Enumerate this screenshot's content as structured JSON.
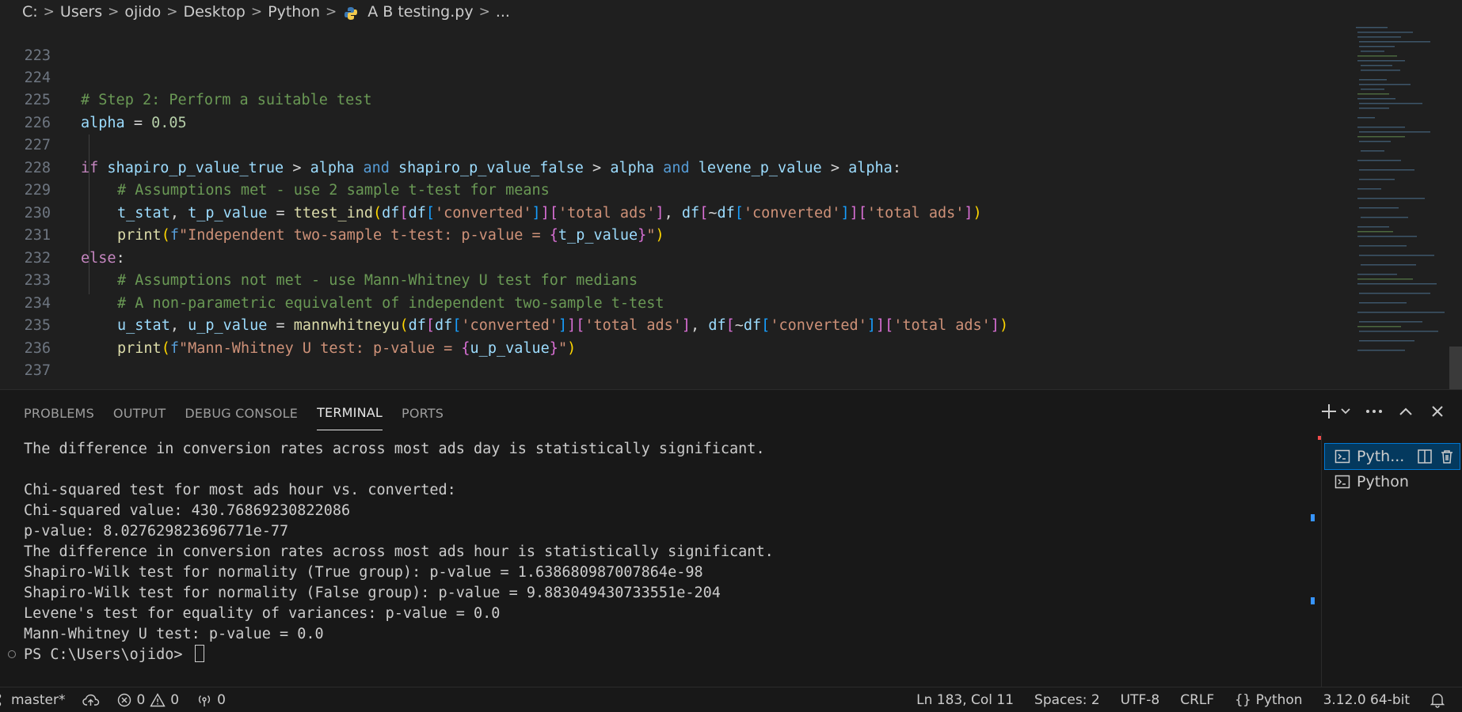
{
  "breadcrumb": {
    "parts": [
      "C:",
      "Users",
      "ojido",
      "Desktop",
      "Python"
    ],
    "file": "A B testing.py",
    "ellipsis": "..."
  },
  "editor": {
    "line_numbers": [
      "223",
      "224",
      "225",
      "226",
      "227",
      "228",
      "229",
      "230",
      "231",
      "232",
      "233",
      "234",
      "235",
      "236",
      "237"
    ],
    "lines": {
      "l224": "# Step 2: Perform a suitable test",
      "l225_var": "alpha",
      "l225_eq": " = ",
      "l225_num": "0.05",
      "l227": {
        "kw_if": "if ",
        "v1": "shapiro_p_value_true",
        "gt1": " > ",
        "a1": "alpha",
        "and1": " and ",
        "v2": "shapiro_p_value_false",
        "gt2": " > ",
        "a2": "alpha",
        "and2": " and ",
        "v3": "levene_p_value",
        "gt3": " > ",
        "a3": "alpha",
        "colon": ":"
      },
      "l228": "# Assumptions met - use 2 sample t-test for means",
      "l229": {
        "v1": "t_stat",
        "comma": ", ",
        "v2": "t_p_value",
        "eq": " = ",
        "fn": "ttest_ind",
        "p1": "(",
        "df1": "df",
        "b1": "[",
        "df2": "df",
        "b2": "[",
        "s1": "'converted'",
        "b2c": "]",
        "b1c": "]",
        "b3": "[",
        "s2": "'total ads'",
        "b3c": "]",
        "comma2": ", ",
        "df3": "df",
        "b4": "[",
        "tilde": "~",
        "df4": "df",
        "b5": "[",
        "s3": "'converted'",
        "b5c": "]",
        "b4c": "]",
        "b6": "[",
        "s4": "'total ads'",
        "b6c": "]",
        "p1c": ")"
      },
      "l230": {
        "fn": "print",
        "p": "(",
        "f": "f",
        "s": "\"Independent two-sample t-test: p-value = ",
        "cb": "{",
        "v": "t_p_value",
        "cbc": "}",
        "e": "\"",
        "pc": ")"
      },
      "l231": "else",
      "l231_colon": ":",
      "l232": "# Assumptions not met - use Mann-Whitney U test for medians",
      "l233": "# A non-parametric equivalent of independent two-sample t-test",
      "l234": {
        "v1": "u_stat",
        "comma": ", ",
        "v2": "u_p_value",
        "eq": " = ",
        "fn": "mannwhitneyu",
        "p1": "(",
        "df1": "df",
        "b1": "[",
        "df2": "df",
        "b2": "[",
        "s1": "'converted'",
        "b2c": "]",
        "b1c": "]",
        "b3": "[",
        "s2": "'total ads'",
        "b3c": "]",
        "comma2": ", ",
        "df3": "df",
        "b4": "[",
        "tilde": "~",
        "df4": "df",
        "b5": "[",
        "s3": "'converted'",
        "b5c": "]",
        "b4c": "]",
        "b6": "[",
        "s4": "'total ads'",
        "b6c": "]",
        "p1c": ")"
      },
      "l235": {
        "fn": "print",
        "p": "(",
        "f": "f",
        "s": "\"Mann-Whitney U test: p-value = ",
        "cb": "{",
        "v": "u_p_value",
        "cbc": "}",
        "e": "\"",
        "pc": ")"
      }
    }
  },
  "panel": {
    "tabs": [
      "PROBLEMS",
      "OUTPUT",
      "DEBUG CONSOLE",
      "TERMINAL",
      "PORTS"
    ],
    "active_tab": "TERMINAL"
  },
  "terminal": {
    "lines": [
      "The difference in conversion rates across most ads day is statistically significant.",
      "",
      "Chi-squared test for most ads hour vs. converted:",
      "Chi-squared value: 430.76869230822086",
      "p-value: 8.027629823696771e-77",
      "The difference in conversion rates across most ads hour is statistically significant.",
      "Shapiro-Wilk test for normality (True group): p-value = 1.638680987007864e-98",
      "Shapiro-Wilk test for normality (False group): p-value = 9.883049430733551e-204",
      "Levene's test for equality of variances: p-value = 0.0",
      "Mann-Whitney U test: p-value = 0.0"
    ],
    "prompt": "PS C:\\Users\\ojido> "
  },
  "terminal_list": {
    "items": [
      "Pyth...",
      "Python"
    ]
  },
  "statusbar": {
    "branch": "master*",
    "errors": "0",
    "warnings": "0",
    "ports": "0",
    "position": "Ln 183, Col 11",
    "spaces": "Spaces: 2",
    "encoding": "UTF-8",
    "eol": "CRLF",
    "language": "Python",
    "interpreter": "3.12.0 64-bit"
  },
  "colors": {
    "background": "#1f1f1f",
    "panel": "#181818",
    "accent": "#0078d4",
    "comment": "#6a9955",
    "keyword": "#c586c0",
    "variable": "#9cdcfe",
    "function": "#dcdcaa",
    "string": "#ce9178",
    "number": "#b5cea8"
  }
}
